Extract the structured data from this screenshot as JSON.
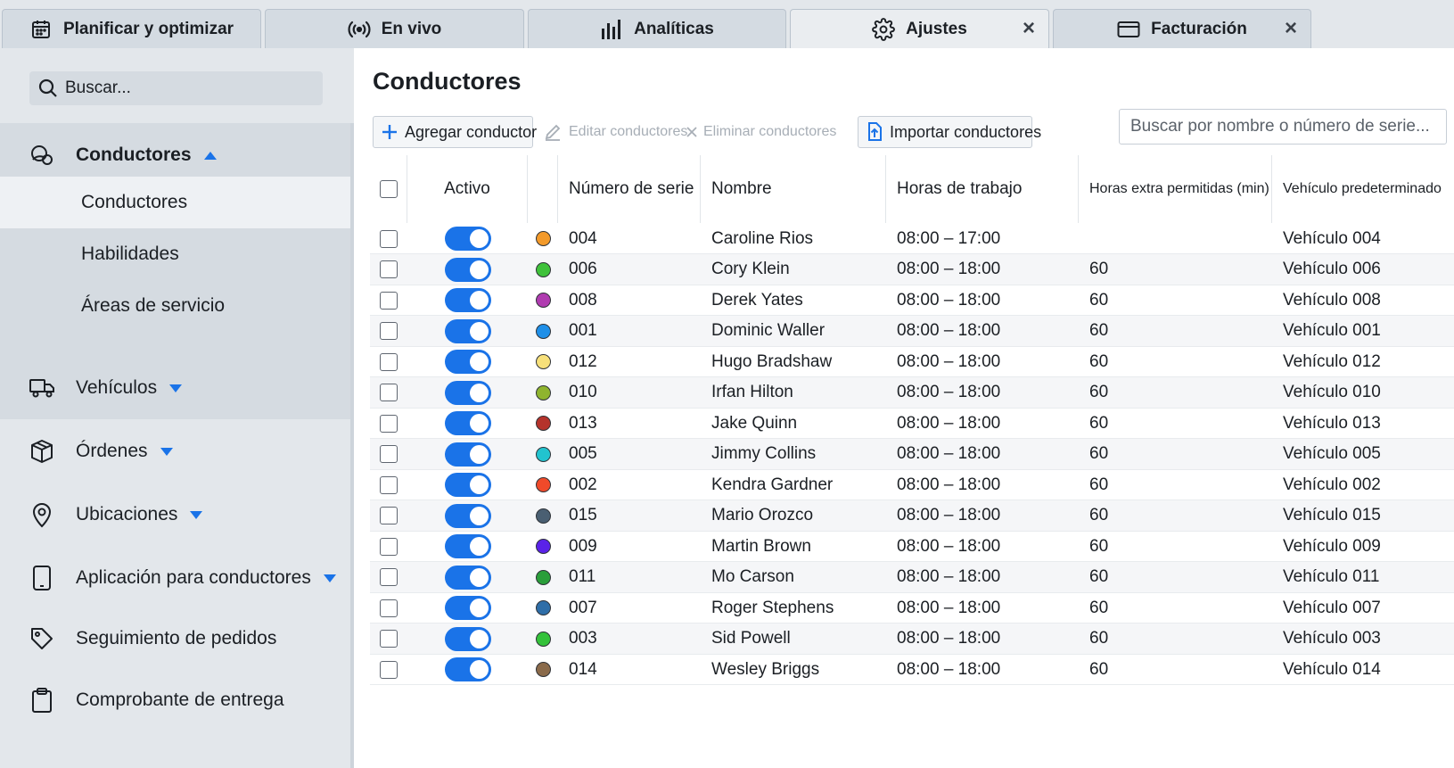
{
  "tabs": [
    {
      "label": "Planificar y optimizar",
      "icon": "calendar-icon",
      "active": false,
      "closable": false
    },
    {
      "label": "En vivo",
      "icon": "broadcast-icon",
      "active": false,
      "closable": false
    },
    {
      "label": "Analíticas",
      "icon": "bar-chart-icon",
      "active": false,
      "closable": false
    },
    {
      "label": "Ajustes",
      "icon": "gear-icon",
      "active": true,
      "closable": true
    },
    {
      "label": "Facturación",
      "icon": "credit-card-icon",
      "active": false,
      "closable": true
    }
  ],
  "sidebar": {
    "search_placeholder": "Buscar...",
    "sections": [
      {
        "label": "Conductores",
        "icon": "drivers-icon",
        "expanded": true,
        "children": [
          {
            "label": "Conductores",
            "selected": true
          },
          {
            "label": "Habilidades",
            "selected": false
          },
          {
            "label": "Áreas de servicio",
            "selected": false
          }
        ]
      },
      {
        "label": "Vehículos",
        "icon": "truck-icon",
        "expanded": false,
        "has_caret": true
      },
      {
        "label": "Órdenes",
        "icon": "package-icon",
        "expanded": false,
        "has_caret": true
      },
      {
        "label": "Ubicaciones",
        "icon": "map-pin-icon",
        "expanded": false,
        "has_caret": true
      },
      {
        "label": "Aplicación para conductores",
        "icon": "phone-icon",
        "expanded": false,
        "has_caret": true
      },
      {
        "label": "Seguimiento de pedidos",
        "icon": "tag-icon",
        "expanded": false,
        "has_caret": false
      },
      {
        "label": "Comprobante de entrega",
        "icon": "clipboard-icon",
        "expanded": false,
        "has_caret": false
      }
    ]
  },
  "main": {
    "title": "Conductores",
    "toolbar": {
      "add_label": "Agregar conductor",
      "edit_label": "Editar conductores",
      "delete_label": "Eliminar conductores",
      "import_label": "Importar conductores"
    },
    "search_placeholder": "Buscar por nombre o número de serie...",
    "columns": {
      "active": "Activo",
      "serial": "Número de serie",
      "name": "Nombre",
      "hours": "Horas de trabajo",
      "overtime": "Horas extra permitidas (min)",
      "vehicle": "Vehículo predeterminado"
    },
    "accent_color": "#1a73e8",
    "rows": [
      {
        "color": "#f39a2a",
        "serial": "004",
        "name": "Caroline Rios",
        "hours": "08:00 – 17:00",
        "overtime": "",
        "vehicle": "Vehículo 004"
      },
      {
        "color": "#3fc23a",
        "serial": "006",
        "name": "Cory Klein",
        "hours": "08:00 – 18:00",
        "overtime": "60",
        "vehicle": "Vehículo 006"
      },
      {
        "color": "#b03bb0",
        "serial": "008",
        "name": "Derek Yates",
        "hours": "08:00 – 18:00",
        "overtime": "60",
        "vehicle": "Vehículo 008"
      },
      {
        "color": "#1e8fe8",
        "serial": "001",
        "name": "Dominic Waller",
        "hours": "08:00 – 18:00",
        "overtime": "60",
        "vehicle": "Vehículo 001"
      },
      {
        "color": "#f7e07a",
        "serial": "012",
        "name": "Hugo Bradshaw",
        "hours": "08:00 – 18:00",
        "overtime": "60",
        "vehicle": "Vehículo 012"
      },
      {
        "color": "#8fb42e",
        "serial": "010",
        "name": "Irfan Hilton",
        "hours": "08:00 – 18:00",
        "overtime": "60",
        "vehicle": "Vehículo 010"
      },
      {
        "color": "#b5332b",
        "serial": "013",
        "name": "Jake Quinn",
        "hours": "08:00 – 18:00",
        "overtime": "60",
        "vehicle": "Vehículo 013"
      },
      {
        "color": "#22c3cf",
        "serial": "005",
        "name": "Jimmy Collins",
        "hours": "08:00 – 18:00",
        "overtime": "60",
        "vehicle": "Vehículo 005"
      },
      {
        "color": "#f04a2a",
        "serial": "002",
        "name": "Kendra Gardner",
        "hours": "08:00 – 18:00",
        "overtime": "60",
        "vehicle": "Vehículo 002"
      },
      {
        "color": "#4a5f72",
        "serial": "015",
        "name": "Mario Orozco",
        "hours": "08:00 – 18:00",
        "overtime": "60",
        "vehicle": "Vehículo 015"
      },
      {
        "color": "#5a22e8",
        "serial": "009",
        "name": "Martin Brown",
        "hours": "08:00 – 18:00",
        "overtime": "60",
        "vehicle": "Vehículo 009"
      },
      {
        "color": "#2a9e3a",
        "serial": "011",
        "name": "Mo Carson",
        "hours": "08:00 – 18:00",
        "overtime": "60",
        "vehicle": "Vehículo 011"
      },
      {
        "color": "#2f6ea8",
        "serial": "007",
        "name": "Roger Stephens",
        "hours": "08:00 – 18:00",
        "overtime": "60",
        "vehicle": "Vehículo 007"
      },
      {
        "color": "#34c23a",
        "serial": "003",
        "name": "Sid Powell",
        "hours": "08:00 – 18:00",
        "overtime": "60",
        "vehicle": "Vehículo 003"
      },
      {
        "color": "#8a6a4a",
        "serial": "014",
        "name": "Wesley Briggs",
        "hours": "08:00 – 18:00",
        "overtime": "60",
        "vehicle": "Vehículo 014"
      }
    ]
  }
}
